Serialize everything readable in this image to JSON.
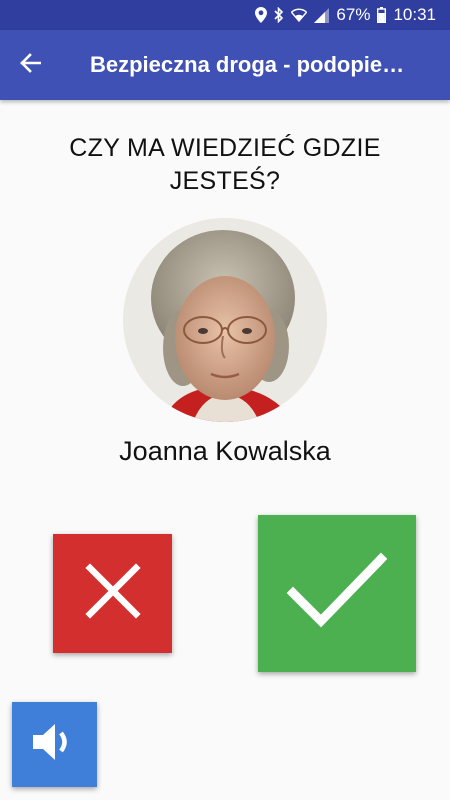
{
  "status_bar": {
    "battery_percent": "67%",
    "time": "10:31",
    "icons": [
      "location-icon",
      "bluetooth-icon",
      "wifi-icon",
      "signal-icon",
      "battery-icon"
    ]
  },
  "app_bar": {
    "title": "Bezpieczna droga - podopie…",
    "back_icon": "arrow-back-icon"
  },
  "question": "CZY MA WIEDZIEĆ GDZIE JESTEŚ?",
  "contact": {
    "name": "Joanna Kowalska"
  },
  "actions": {
    "no_icon": "close-icon",
    "yes_icon": "check-icon",
    "sound_icon": "volume-icon"
  },
  "colors": {
    "status_bar": "#303f9f",
    "app_bar": "#3f51b5",
    "no_button": "#d32f2f",
    "yes_button": "#4caf50",
    "sound_button": "#3f7fd9"
  }
}
